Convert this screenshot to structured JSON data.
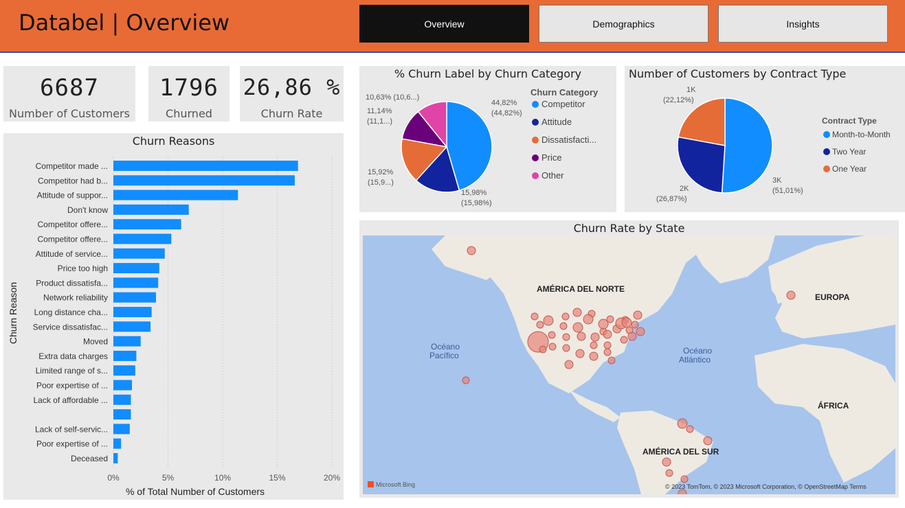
{
  "header": {
    "title": "Databel | Overview",
    "nav": [
      {
        "label": "Overview",
        "active": true
      },
      {
        "label": "Demographics",
        "active": false
      },
      {
        "label": "Insights",
        "active": false
      }
    ]
  },
  "kpis": [
    {
      "value": "6687",
      "label": "Number of Customers"
    },
    {
      "value": "1796",
      "label": "Churned"
    },
    {
      "value": "26,86 %",
      "label": "Churn Rate"
    }
  ],
  "colors": {
    "header": "#e86b35",
    "bar": "#118dff",
    "competitor": "#118dff",
    "attitude": "#12239e",
    "dissatisfaction": "#e66c37",
    "price": "#6b007b",
    "other": "#e044a7",
    "bubble": "#e8847a"
  },
  "chart_data": [
    {
      "type": "bar",
      "title": "Churn Reasons",
      "orientation": "horizontal",
      "xlabel": "% of Total Number of Customers",
      "ylabel": "Churn Reason",
      "xlim": [
        0,
        20
      ],
      "xticks": [
        "0%",
        "5%",
        "10%",
        "15%",
        "20%"
      ],
      "categories": [
        "Competitor made ...",
        "Competitor had b...",
        "Attitude of suppor...",
        "Don't know",
        "Competitor offere...",
        "Competitor offere...",
        "Attitude of service...",
        "Price too high",
        "Product dissatisfa...",
        "Network reliability",
        "Long distance cha...",
        "Service dissatisfac...",
        "Moved",
        "Extra data charges",
        "Limited range of s...",
        "Poor expertise of ...",
        "Lack of affordable ...",
        "",
        "Lack of self-servic...",
        "Poor expertise of ...",
        "Deceased"
      ],
      "values": [
        16.9,
        16.6,
        11.4,
        6.9,
        6.2,
        5.3,
        4.7,
        4.2,
        4.1,
        3.9,
        3.5,
        3.4,
        2.5,
        2.1,
        2.0,
        1.7,
        1.6,
        1.6,
        1.5,
        0.7,
        0.4
      ]
    },
    {
      "type": "pie",
      "title": "% Churn Label by Churn Category",
      "legend_title": "Churn Category",
      "legend_position": "right",
      "categories": [
        "Competitor",
        "Attitude",
        "Dissatisfacti...",
        "Price",
        "Other"
      ],
      "values": [
        44.82,
        15.98,
        15.92,
        11.14,
        10.63
      ],
      "labels": [
        [
          "44,82%",
          "(44,82%)"
        ],
        [
          "15,98%",
          "(15,98%)"
        ],
        [
          "15,92%",
          "(15,9...)"
        ],
        [
          "11,14%",
          "(11,1...)"
        ],
        [
          "10,63% (10,6...)"
        ]
      ]
    },
    {
      "type": "pie",
      "title": "Number of Customers by Contract Type",
      "legend_title": "Contract Type",
      "legend_position": "right",
      "categories": [
        "Month-to-Month",
        "Two Year",
        "One Year"
      ],
      "values": [
        51.01,
        26.87,
        22.12
      ],
      "labels": [
        [
          "3K",
          "(51,01%)"
        ],
        [
          "2K",
          "(26,87%)"
        ],
        [
          "1K",
          "(22,12%)"
        ]
      ]
    }
  ],
  "map": {
    "title": "Churn Rate by State",
    "labels": [
      "AMÉRICA DEL NORTE",
      "EUROPA",
      "Océano",
      "Pacífico",
      "Océano",
      "Atlántico",
      "ÁFRICA",
      "AMÉRICA DEL SUR"
    ],
    "attribution": "© 2023 TomTom, © 2023 Microsoft Corporation, © OpenStreetMap  Terms",
    "brand": "Microsoft Bing"
  }
}
